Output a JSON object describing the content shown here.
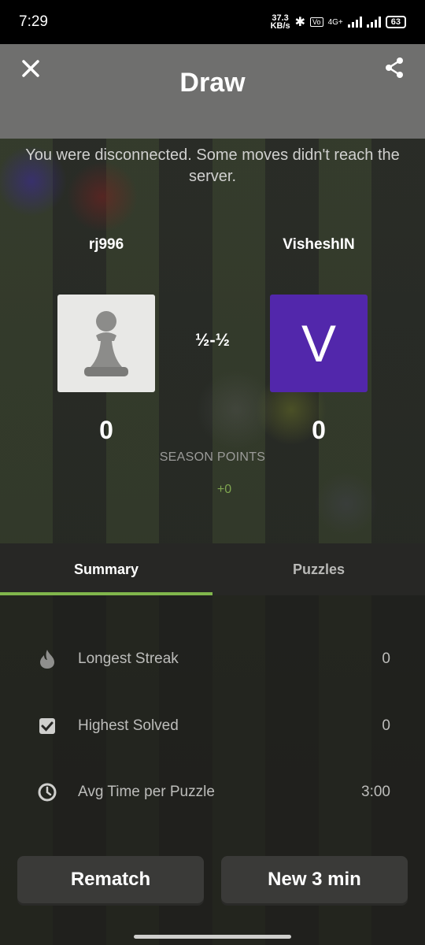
{
  "status_bar": {
    "time": "7:29",
    "speed_value": "37.3",
    "speed_unit": "KB/s",
    "network": "4G+",
    "battery": "63"
  },
  "header": {
    "title": "Draw",
    "close_icon": "close-icon",
    "share_icon": "share-icon"
  },
  "notice": "You were disconnected. Some moves didn't reach the server.",
  "players": {
    "left": {
      "name": "rj996",
      "avatar": "pawn-icon",
      "points": "0"
    },
    "right": {
      "name": "VisheshIN",
      "avatar_letter": "V",
      "avatar_color": "#5227ab",
      "points": "0"
    }
  },
  "result": "½-½",
  "season": {
    "label": "SEASON POINTS",
    "delta": "+0"
  },
  "tabs": [
    {
      "label": "Summary",
      "active": true
    },
    {
      "label": "Puzzles",
      "active": false
    }
  ],
  "stats": [
    {
      "icon": "flame-icon",
      "label": "Longest Streak",
      "value": "0"
    },
    {
      "icon": "checkbox-icon",
      "label": "Highest Solved",
      "value": "0"
    },
    {
      "icon": "clock-icon",
      "label": "Avg Time per Puzzle",
      "value": "3:00"
    }
  ],
  "buttons": {
    "rematch": "Rematch",
    "new_game": "New 3 min"
  },
  "colors": {
    "accent": "#81b64c",
    "header": "#6f6f6e",
    "button": "#3a3a38"
  }
}
